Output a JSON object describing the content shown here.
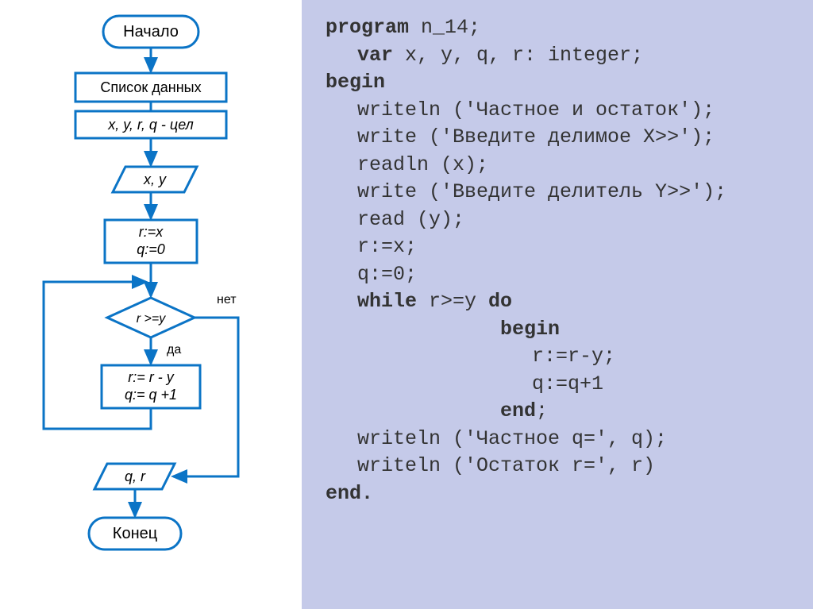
{
  "flowchart": {
    "start": "Начало",
    "datalist_title": "Список данных",
    "datalist_vars": "x, y, r, q - цел",
    "input": "x, y",
    "init_l1": "r:=x",
    "init_l2": "q:=0",
    "cond": "r >=y",
    "cond_no": "нет",
    "cond_yes": "да",
    "body_l1": "r:= r - y",
    "body_l2": "q:= q +1",
    "output": "q,  r",
    "end": "Конец"
  },
  "code": {
    "l1a": "program",
    "l1b": " n_14;",
    "l2a": "var",
    "l2b": "  x, y, q, r: integer;",
    "l3": "begin",
    "l4": "writeln ('Частное и остаток');",
    "l5": "write ('Введите делимое X>>');",
    "l6": "readln (x);",
    "l7": "write ('Введите делитель Y>>');",
    "l8": "read (y);",
    "l9": "r:=x;",
    "l10": "q:=0;",
    "l11a": "while",
    "l11b": " r>=y ",
    "l11c": "do",
    "l12": "begin",
    "l13": "r:=r-y;",
    "l14": "q:=q+1",
    "l15": "end",
    "l15b": ";",
    "l16": "writeln ('Частное q=', q);",
    "l17": "writeln ('Остаток r=', r)",
    "l18": "end."
  }
}
